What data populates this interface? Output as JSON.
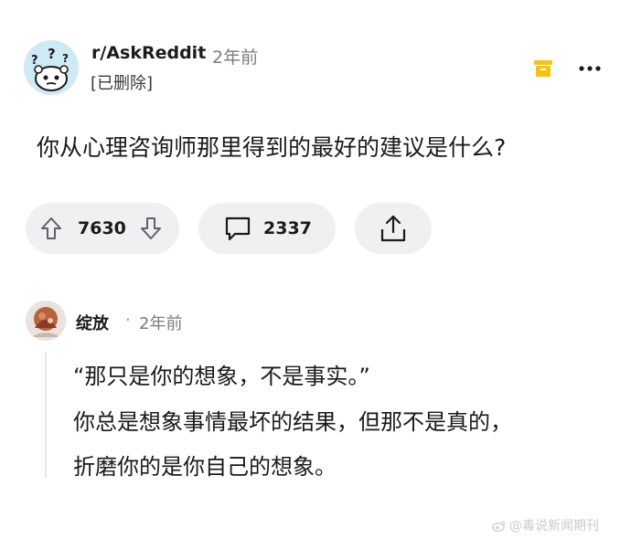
{
  "post": {
    "subreddit": "r/AskReddit",
    "time": "2年前",
    "author": "[已删除]",
    "title": "你从心理咨询师那里得到的最好的建议是什么?"
  },
  "actions": {
    "upvotes": "7630",
    "comments": "2337"
  },
  "comment": {
    "author": "绽放",
    "separator": "·",
    "time": "2年前",
    "lines": [
      "“那只是你的想象，不是事实。”",
      "你总是想象事情最坏的结果，但那不是真的，",
      "折磨你的是你自己的想象。"
    ]
  },
  "watermark": "@毒说新闻期刊",
  "icons": {
    "subreddit_avatar": "reddit-snoo-confused-icon",
    "archive": "archive-box-icon",
    "more": "more-dots-icon",
    "upvote": "arrow-up-icon",
    "downvote": "arrow-down-icon",
    "comment": "comment-bubble-icon",
    "share": "share-upload-icon",
    "commenter_avatar": "user-avatar"
  },
  "colors": {
    "accent": "#f2c318",
    "pill_bg": "#eef0f2",
    "avatar_bg": "#cfe9f5"
  }
}
